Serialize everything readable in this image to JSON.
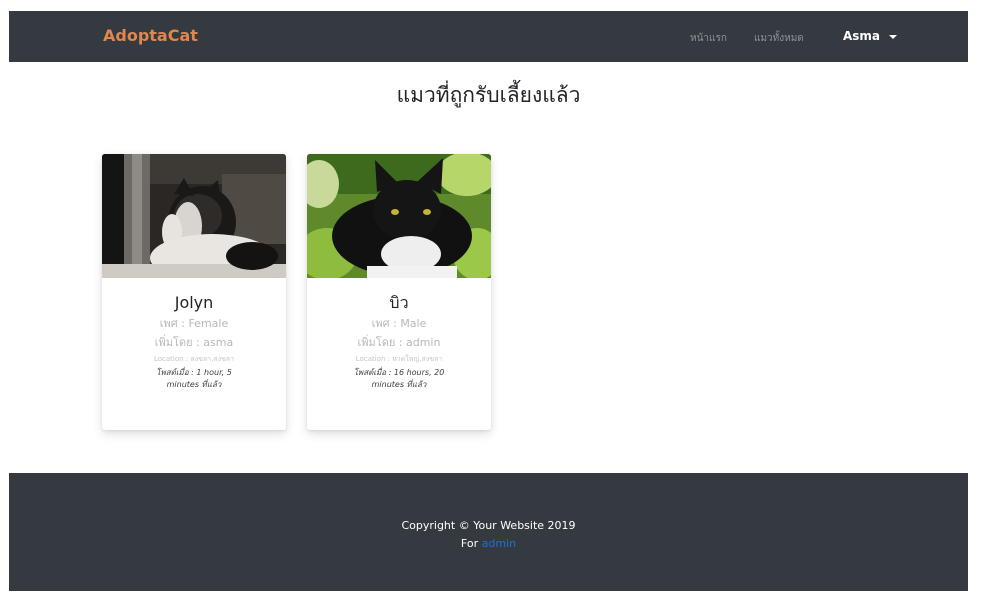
{
  "navbar": {
    "brand": "AdoptaCat",
    "links": [
      "หน้าแรก",
      "แมวทั้งหมด"
    ],
    "user": "Asma"
  },
  "page": {
    "title": "แมวที่ถูกรับเลี้ยงแล้ว"
  },
  "cats": [
    {
      "name": "Jolyn",
      "gender": "เพศ : Female",
      "added_by": "เพิ่มโดย : asma",
      "location": "Location : สงขลา,สงขลา",
      "posted": "โพสต์เมื่อ : 1 hour, 5 minutes ที่แล้ว"
    },
    {
      "name": "บิว",
      "gender": "เพศ : Male",
      "added_by": "เพิ่มโดย : admin",
      "location": "Location : หาดใหญ่,สงขลา",
      "posted": "โพสต์เมื่อ : 16 hours, 20 minutes ที่แล้ว"
    }
  ],
  "footer": {
    "copyright": "Copyright © Your Website 2019",
    "for_label": "For",
    "for_link": "admin"
  }
}
